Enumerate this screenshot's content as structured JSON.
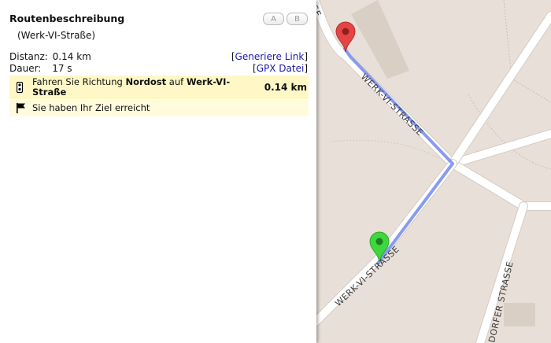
{
  "panel": {
    "title": "Routenbeschreibung",
    "subtitle": "(Werk-VI-Straße)",
    "btn_a": "A",
    "btn_b": "B",
    "distance_label": "Distanz:",
    "distance_value": "0.14 km",
    "duration_label": "Dauer:",
    "duration_value": "17 s",
    "link_generate": "Generiere Link",
    "link_gpx": "GPX Datei",
    "bracket_open": "[",
    "bracket_close": "]",
    "steps": [
      {
        "icon": "traffic-light-icon",
        "text_prefix": "Fahren Sie Richtung ",
        "direction": "Nordost",
        "text_mid": " auf ",
        "street": "Werk-VI-Straße",
        "distance": "0.14 km"
      },
      {
        "icon": "flag-icon",
        "text": "Sie haben Ihr Ziel erreicht"
      }
    ]
  },
  "map": {
    "street_labels": [
      "WERK-VI-STRASSE",
      "WERK-VI-STRASSE",
      "DORFER STRASSE"
    ],
    "route_color": "#7b90f0",
    "start_marker_color": "#3ed83e",
    "end_marker_color": "#e64444"
  }
}
